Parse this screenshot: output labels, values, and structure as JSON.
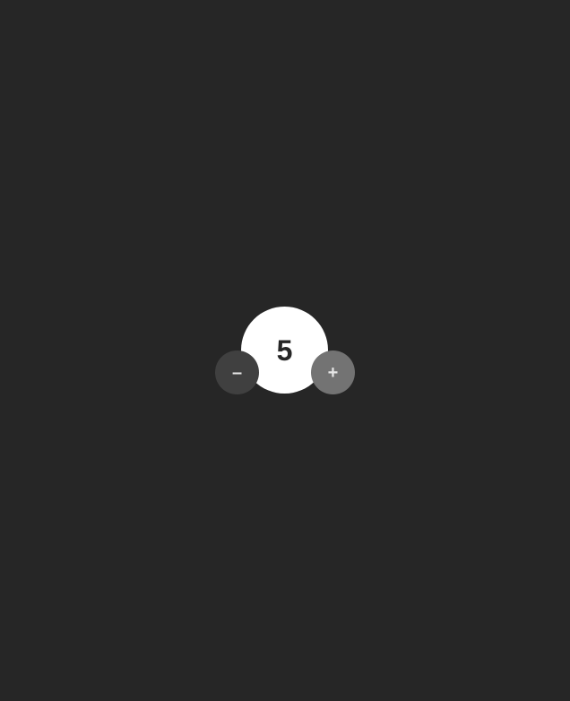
{
  "counter": {
    "value": "5"
  },
  "controls": {
    "decrement_label": "–",
    "increment_label": "+"
  },
  "colors": {
    "background": "#262626",
    "counter_fill": "#ffffff",
    "counter_text": "#262626",
    "decrement_fill": "#404040",
    "increment_fill": "#737373",
    "button_text": "#e6e6e6"
  }
}
